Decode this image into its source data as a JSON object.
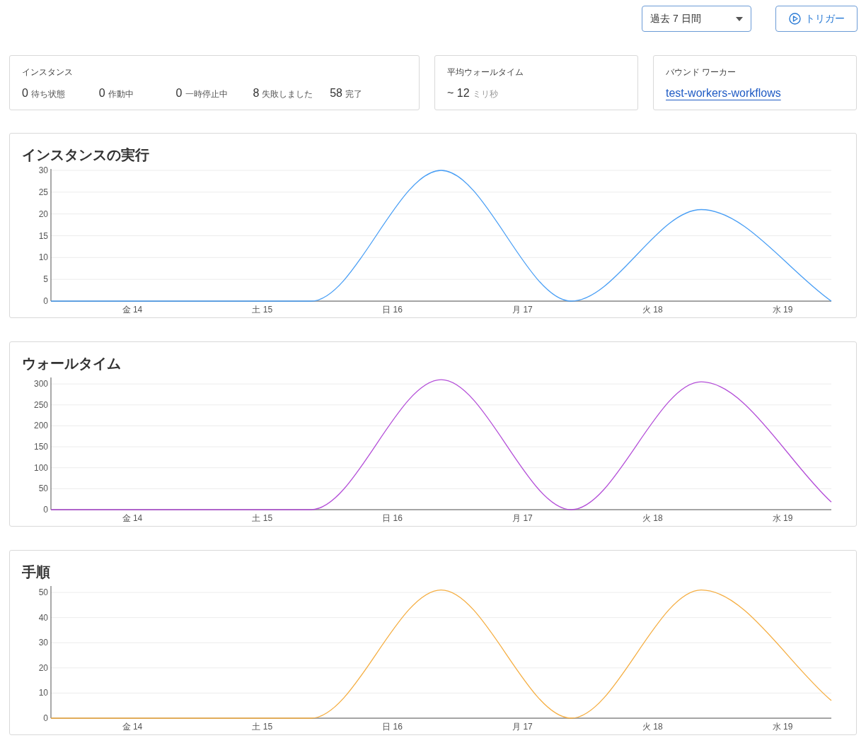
{
  "toolbar": {
    "range_select": {
      "value": "過去 7 日間"
    },
    "trigger_button": {
      "label": "トリガー"
    }
  },
  "stats": {
    "instances": {
      "title": "インスタンス",
      "items": [
        {
          "value": "0",
          "label": "待ち状態"
        },
        {
          "value": "0",
          "label": "作動中"
        },
        {
          "value": "0",
          "label": "一時停止中"
        },
        {
          "value": "8",
          "label": "失敗しました"
        },
        {
          "value": "58",
          "label": "完了"
        }
      ]
    },
    "wall_time": {
      "title": "平均ウォールタイム",
      "value": "~ 12",
      "unit": "ミリ秒"
    },
    "bound_worker": {
      "title": "バウンド ワーカー",
      "link": "test-workers-workflows"
    }
  },
  "charts": [
    {
      "chart_data": {
        "type": "line",
        "title": "インスタンスの実行",
        "grid": true,
        "categories": [
          null,
          null,
          null,
          null,
          null,
          "金 14",
          null,
          null,
          null,
          null,
          null,
          null,
          null,
          "土 15",
          null,
          null,
          null,
          null,
          null,
          null,
          null,
          "日 16",
          null,
          null,
          null,
          null,
          null,
          null,
          null,
          "月 17",
          null,
          null,
          null,
          null,
          null,
          null,
          null,
          "火 18",
          null,
          null,
          null,
          null,
          null,
          null,
          null,
          "水 19",
          null,
          null,
          null
        ],
        "series": [
          {
            "color": "#4a9ff5",
            "values": [
              0,
              null,
              null,
              null,
              null,
              null,
              null,
              null,
              0,
              null,
              null,
              null,
              null,
              null,
              null,
              null,
              0,
              null,
              null,
              null,
              null,
              null,
              null,
              null,
              30,
              null,
              null,
              null,
              null,
              null,
              null,
              null,
              0,
              null,
              null,
              null,
              null,
              null,
              null,
              null,
              21,
              null,
              null,
              null,
              null,
              null,
              null,
              null,
              0
            ]
          }
        ],
        "ylim": [
          0,
          30
        ],
        "yticks": [
          0,
          5,
          10,
          15,
          20,
          25,
          30
        ]
      }
    },
    {
      "chart_data": {
        "type": "line",
        "title": "ウォールタイム",
        "grid": true,
        "categories": [
          null,
          null,
          null,
          null,
          null,
          "金 14",
          null,
          null,
          null,
          null,
          null,
          null,
          null,
          "土 15",
          null,
          null,
          null,
          null,
          null,
          null,
          null,
          "日 16",
          null,
          null,
          null,
          null,
          null,
          null,
          null,
          "月 17",
          null,
          null,
          null,
          null,
          null,
          null,
          null,
          "火 18",
          null,
          null,
          null,
          null,
          null,
          null,
          null,
          "水 19",
          null,
          null,
          null
        ],
        "series": [
          {
            "color": "#b44fd8",
            "values": [
              0,
              null,
              null,
              null,
              null,
              null,
              null,
              null,
              0,
              null,
              null,
              null,
              null,
              null,
              null,
              null,
              0,
              null,
              null,
              null,
              null,
              null,
              null,
              null,
              310,
              null,
              null,
              null,
              null,
              null,
              null,
              null,
              0,
              null,
              null,
              null,
              null,
              null,
              null,
              null,
              305,
              null,
              null,
              null,
              null,
              null,
              null,
              null,
              18
            ]
          }
        ],
        "ylim": [
          0,
          312
        ],
        "yticks": [
          0,
          50,
          100,
          150,
          200,
          250,
          300
        ]
      }
    },
    {
      "chart_data": {
        "type": "line",
        "title": "手順",
        "grid": true,
        "categories": [
          null,
          null,
          null,
          null,
          null,
          "金 14",
          null,
          null,
          null,
          null,
          null,
          null,
          null,
          "土 15",
          null,
          null,
          null,
          null,
          null,
          null,
          null,
          "日 16",
          null,
          null,
          null,
          null,
          null,
          null,
          null,
          "月 17",
          null,
          null,
          null,
          null,
          null,
          null,
          null,
          "火 18",
          null,
          null,
          null,
          null,
          null,
          null,
          null,
          "水 19",
          null,
          null,
          null
        ],
        "series": [
          {
            "color": "#f5ae42",
            "values": [
              0,
              null,
              null,
              null,
              null,
              null,
              null,
              null,
              0,
              null,
              null,
              null,
              null,
              null,
              null,
              null,
              0,
              null,
              null,
              null,
              null,
              null,
              null,
              null,
              51,
              null,
              null,
              null,
              null,
              null,
              null,
              null,
              0,
              null,
              null,
              null,
              null,
              null,
              null,
              null,
              51,
              null,
              null,
              null,
              null,
              null,
              null,
              null,
              7
            ]
          }
        ],
        "ylim": [
          0,
          52
        ],
        "yticks": [
          0,
          10,
          20,
          30,
          40,
          50
        ]
      }
    }
  ]
}
